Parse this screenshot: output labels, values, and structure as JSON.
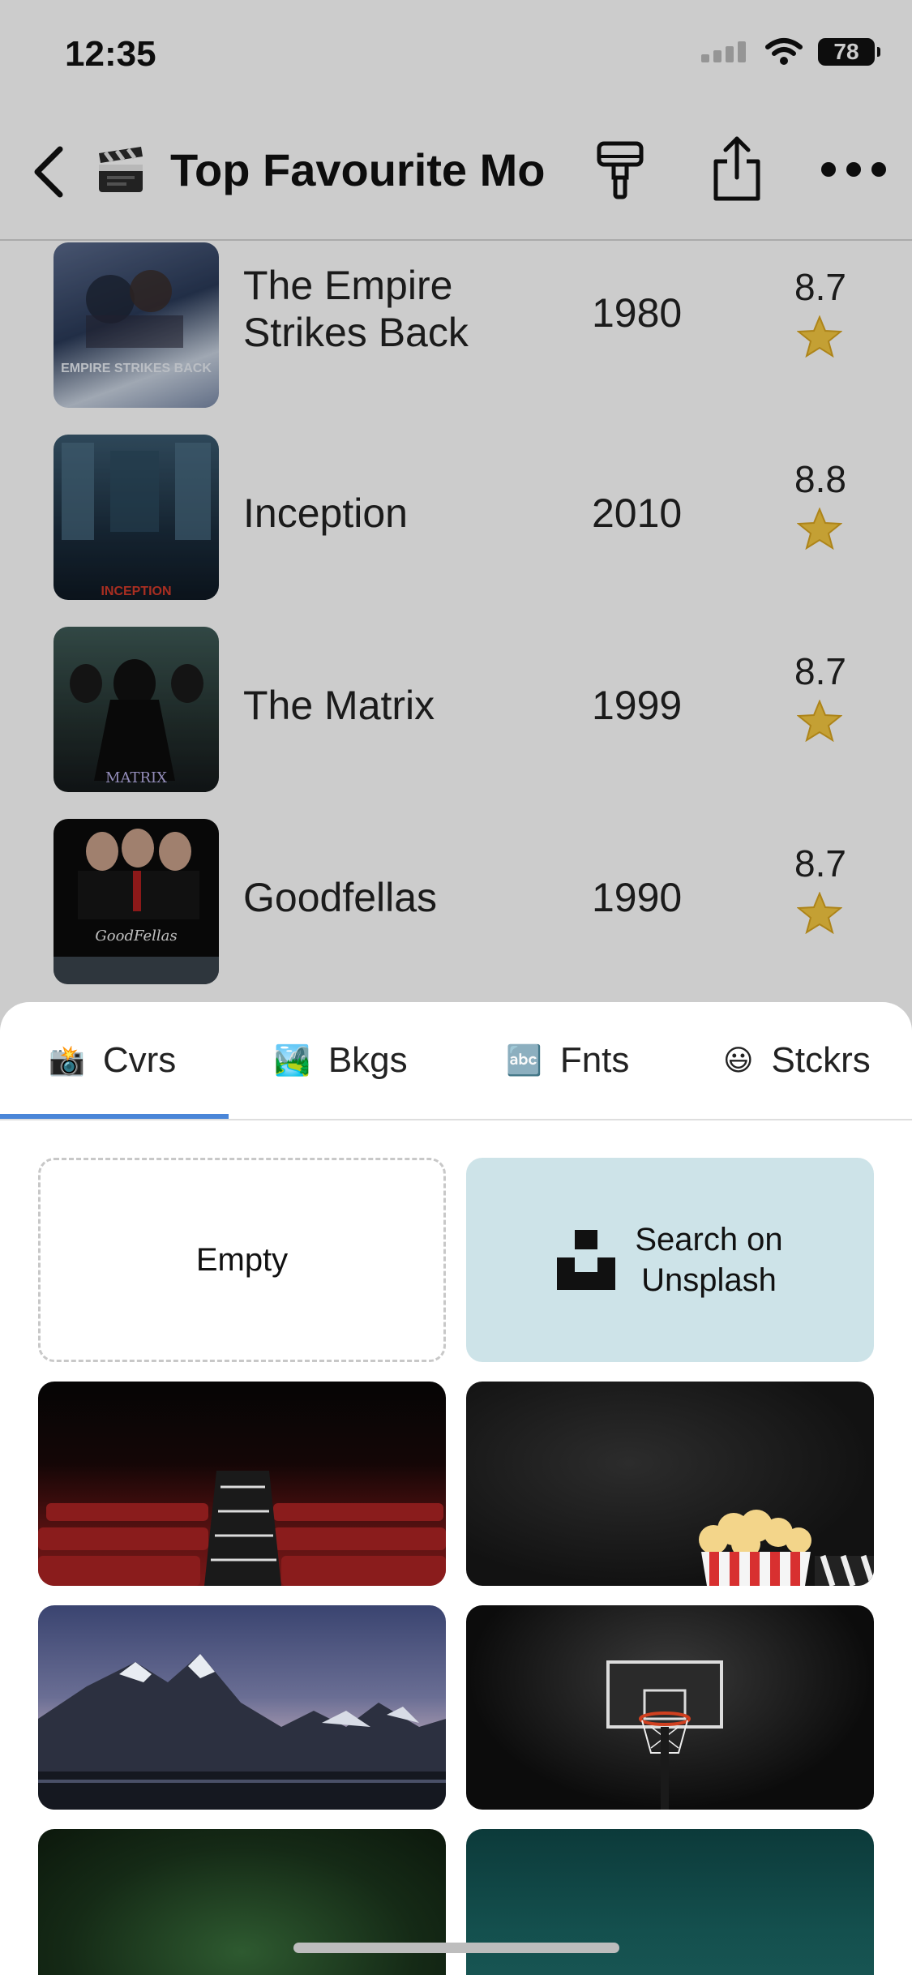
{
  "status_bar": {
    "time": "12:35",
    "battery": "78"
  },
  "nav": {
    "title": "Top Favourite Mo",
    "title_icon": "clapper-board-icon"
  },
  "movies": [
    {
      "title": "The Empire Strikes Back",
      "year": "1980",
      "rating": "8.7",
      "poster_caption": "EMPIRE STRIKES BACK"
    },
    {
      "title": "Inception",
      "year": "2010",
      "rating": "8.8",
      "poster_caption": "INCEPTION"
    },
    {
      "title": "The Matrix",
      "year": "1999",
      "rating": "8.7",
      "poster_caption": "MATRIX"
    },
    {
      "title": "Goodfellas",
      "year": "1990",
      "rating": "8.7",
      "poster_caption": "GoodFellas"
    }
  ],
  "sheet": {
    "tabs": [
      {
        "emoji": "📸",
        "label": "Cvrs",
        "icon": "camera-flash-icon"
      },
      {
        "emoji": "🏞️",
        "label": "Bkgs",
        "icon": "landscape-icon"
      },
      {
        "emoji": "🔤",
        "label": "Fnts",
        "icon": "abc-icon"
      },
      {
        "emoji": "😃",
        "label": "Stckrs",
        "icon": "smiley-icon"
      }
    ],
    "active_tab": "Cvrs",
    "empty_label": "Empty",
    "unsplash_label_1": "Search on",
    "unsplash_label_2": "Unsplash",
    "covers": [
      {
        "name": "cinema-seats"
      },
      {
        "name": "popcorn-dark"
      },
      {
        "name": "mountain-range"
      },
      {
        "name": "basketball-hoop"
      },
      {
        "name": "green-dark"
      },
      {
        "name": "underwater-teal"
      }
    ]
  },
  "colors": {
    "accent": "#4a86d8",
    "unsplash_tile": "#cde3e8"
  }
}
